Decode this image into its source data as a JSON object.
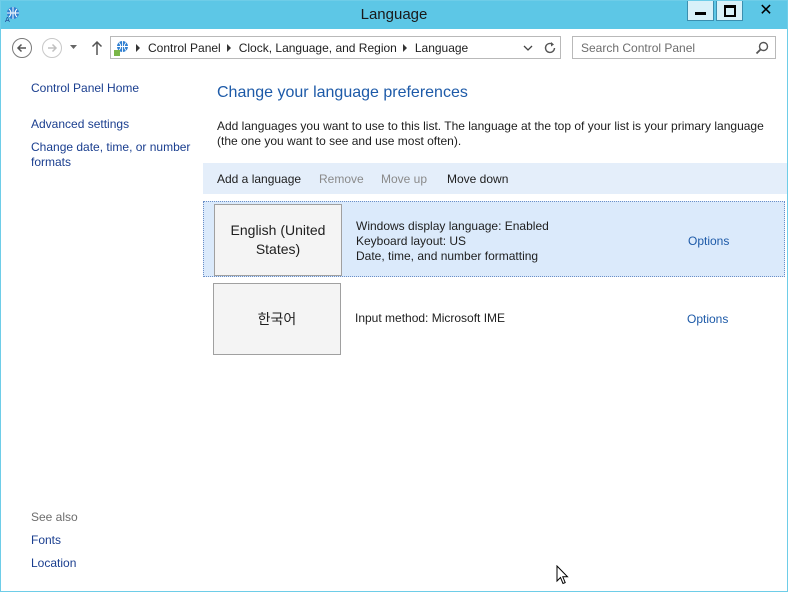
{
  "window": {
    "title": "Language",
    "accent_color": "#5dc7e6"
  },
  "address_bar": {
    "icon": "control-panel-icon",
    "breadcrumbs": [
      "Control Panel",
      "Clock, Language, and Region",
      "Language"
    ]
  },
  "search": {
    "placeholder": "Search Control Panel"
  },
  "sidebar": {
    "home": "Control Panel Home",
    "items": [
      "Advanced settings",
      "Change date, time, or number formats"
    ],
    "see_also_title": "See also",
    "see_also": [
      "Fonts",
      "Location"
    ]
  },
  "main": {
    "heading": "Change your language preferences",
    "description": "Add languages you want to use to this list. The language at the top of your list is your primary language (the one you want to see and use most often).",
    "toolbar": {
      "add": "Add a language",
      "remove": "Remove",
      "move_up": "Move up",
      "move_down": "Move down"
    },
    "languages": [
      {
        "name": "English (United States)",
        "details": [
          "Windows display language: Enabled",
          "Keyboard layout: US",
          "Date, time, and number formatting"
        ],
        "options": "Options",
        "selected": true
      },
      {
        "name": "한국어",
        "details": [
          "Input method: Microsoft IME"
        ],
        "options": "Options",
        "selected": false
      }
    ]
  }
}
